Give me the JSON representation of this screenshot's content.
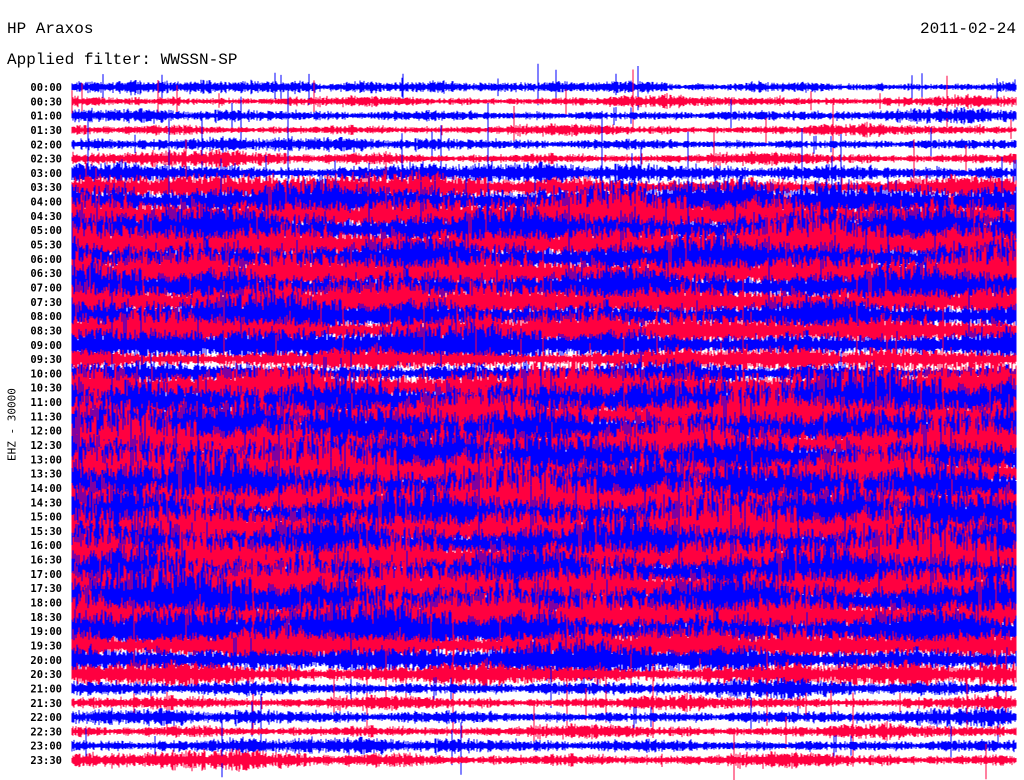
{
  "header": {
    "station": "HP Araxos",
    "filter": "Applied filter: WWSSN-SP",
    "date": "2011-02-24"
  },
  "chart_data": {
    "type": "line",
    "title": "HP Araxos",
    "subtitle": "Applied filter: WWSSN-SP",
    "date": "2011-02-24",
    "ylabel": "EHZ - 30000",
    "row_colors": [
      "#0000ff",
      "#ff0040"
    ],
    "row_labels": [
      "00:00",
      "00:30",
      "01:00",
      "01:30",
      "02:00",
      "02:30",
      "03:00",
      "03:30",
      "04:00",
      "04:30",
      "05:00",
      "05:30",
      "06:00",
      "06:30",
      "07:00",
      "07:30",
      "08:00",
      "08:30",
      "09:00",
      "09:30",
      "10:00",
      "10:30",
      "11:00",
      "11:30",
      "12:00",
      "12:30",
      "13:00",
      "13:30",
      "14:00",
      "14:30",
      "15:00",
      "15:30",
      "16:00",
      "16:30",
      "17:00",
      "17:30",
      "18:00",
      "18:30",
      "19:00",
      "19:30",
      "20:00",
      "20:30",
      "21:00",
      "21:30",
      "22:00",
      "22:30",
      "23:00",
      "23:30"
    ],
    "relative_amplitude": [
      0.45,
      0.45,
      0.45,
      0.45,
      0.45,
      0.5,
      0.7,
      0.9,
      1.6,
      1.8,
      1.8,
      1.8,
      1.8,
      1.8,
      1.7,
      1.6,
      1.5,
      1.4,
      1.3,
      0.9,
      0.8,
      2.0,
      2.2,
      2.2,
      2.2,
      2.2,
      2.2,
      2.2,
      2.2,
      2.2,
      2.2,
      2.2,
      2.2,
      2.2,
      2.2,
      2.2,
      2.2,
      2.0,
      1.8,
      1.4,
      1.2,
      0.9,
      0.6,
      0.55,
      0.55,
      0.55,
      0.55,
      0.6
    ]
  }
}
